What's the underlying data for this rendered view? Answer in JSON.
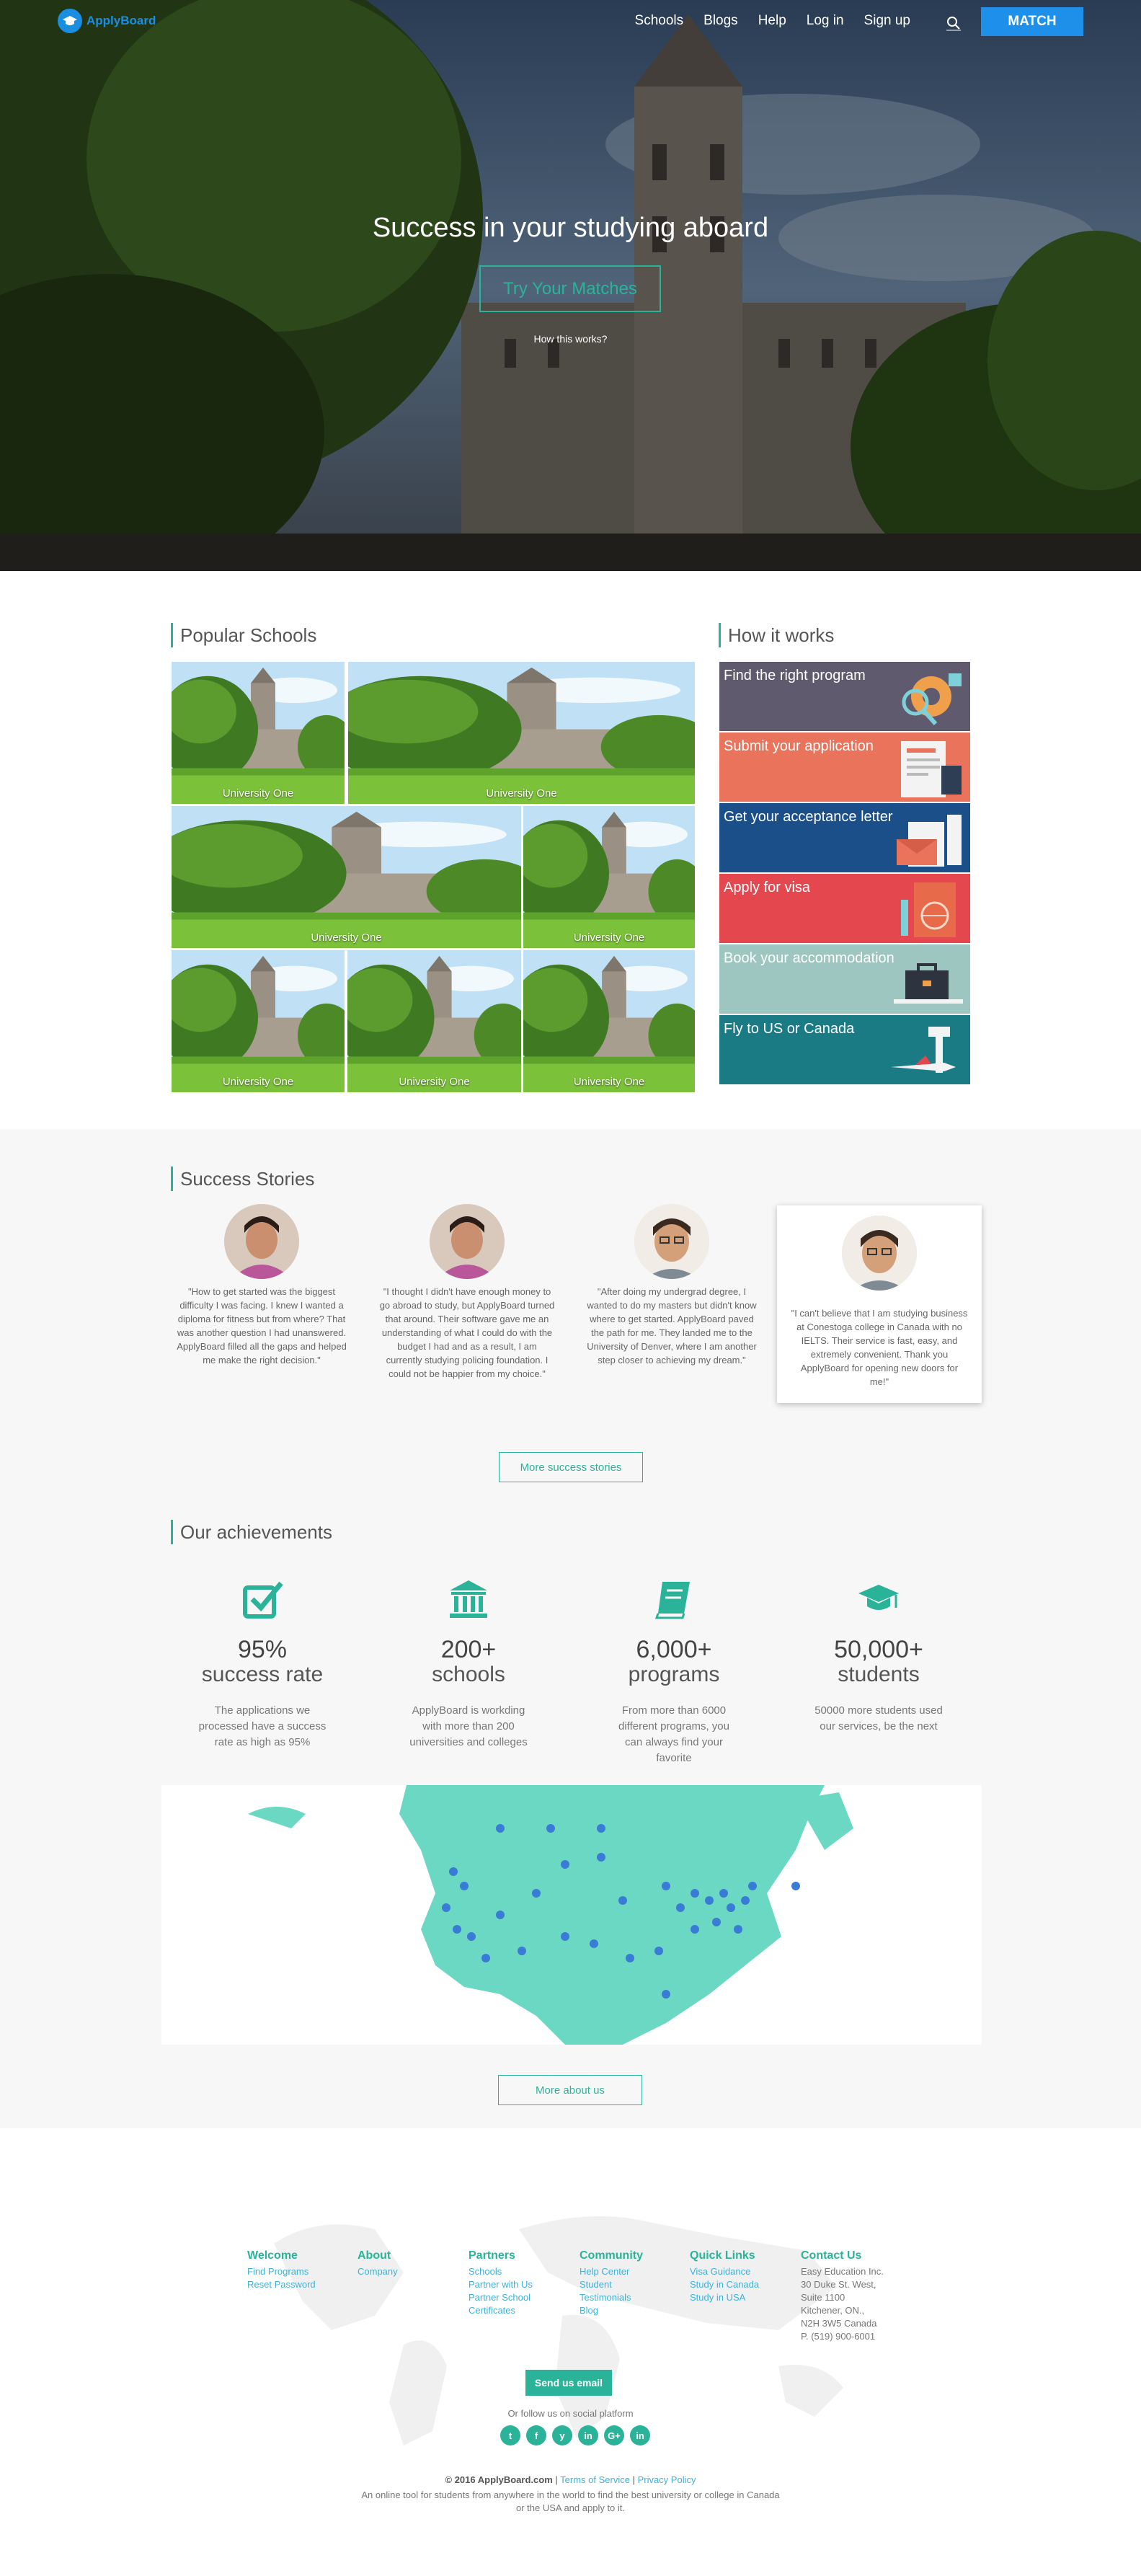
{
  "nav": {
    "logo_text": "ApplyBoard",
    "links": [
      "Schools",
      "Blogs",
      "Help",
      "Log in",
      "Sign up"
    ],
    "match_label": "MATCH"
  },
  "hero": {
    "title": "Success in your studying aboard",
    "cta_label": "Try Your Matches",
    "how_link": "How this works?"
  },
  "popular": {
    "heading": "Popular Schools",
    "tile_label": "University One"
  },
  "how": {
    "heading": "How it works",
    "steps": [
      {
        "label": "Find the right program",
        "color": "#5f5a6e"
      },
      {
        "label": "Submit your application",
        "color": "#e9735b"
      },
      {
        "label": "Get your acceptance letter",
        "color": "#1b4f8a"
      },
      {
        "label": "Apply for visa",
        "color": "#e5474f"
      },
      {
        "label": "Book your accommodation",
        "color": "#9cc6bf"
      },
      {
        "label": "Fly to US or Canada",
        "color": "#1b7b84"
      }
    ]
  },
  "stories": {
    "heading": "Success Stories",
    "items": [
      {
        "text": "\"How to get started was the biggest difficulty I was facing. I knew I wanted a diploma for fitness but from where? That was another question I had unanswered. ApplyBoard filled all the gaps and helped me make the right decision.\""
      },
      {
        "text": "\"I thought I didn't have enough money to go abroad to study, but ApplyBoard turned that around. Their software gave me an understanding of what I could do with the budget I had and as a result, I am currently studying policing foundation. I could not be happier from my choice.\""
      },
      {
        "text": "\"After doing my undergrad degree, I wanted to do my masters but didn't know where to get started. ApplyBoard paved the path for me. They landed me to the University of Denver, where I am another step closer to achieving my dream.\""
      },
      {
        "text": "\"I can't believe that I am studying business at Conestoga college in Canada with no IELTS. Their service is fast, easy, and extremely convenient. Thank you ApplyBoard for opening new doors for me!\""
      }
    ],
    "more_label": "More success stories"
  },
  "achievements": {
    "heading": "Our achievements",
    "items": [
      {
        "num": "95%",
        "unit": "success rate",
        "desc": "The applications we processed have a success rate as high as 95%",
        "icon": "checkbox-icon"
      },
      {
        "num": "200+",
        "unit": "schools",
        "desc": "ApplyBoard is workding with more than 200 universities and colleges",
        "icon": "institution-icon"
      },
      {
        "num": "6,000+",
        "unit": "programs",
        "desc": "From more than 6000 different programs, you can always find your favorite",
        "icon": "book-icon"
      },
      {
        "num": "50,000+",
        "unit": "students",
        "desc": "50000 more students used our services, be the next",
        "icon": "graduation-cap-icon"
      }
    ],
    "more_label": "More about us"
  },
  "footer": {
    "columns": [
      {
        "head": "Welcome",
        "links": [
          "Find Programs",
          "Reset Password"
        ]
      },
      {
        "head": "About",
        "links": [
          "Company"
        ]
      },
      {
        "head": "Partners",
        "links": [
          "Schools",
          "Partner with Us",
          "Partner School Certificates"
        ]
      },
      {
        "head": "Community",
        "links": [
          "Help Center",
          "Student Testimonials",
          "Blog"
        ]
      },
      {
        "head": "Quick Links",
        "links": [
          "Visa Guidance",
          "Study in Canada",
          "Study in USA"
        ]
      },
      {
        "head": "Contact Us",
        "lines": [
          "Easy Education Inc.",
          "30 Duke St. West,",
          "Suite 1100",
          "Kitchener, ON.,",
          "N2H 3W5 Canada",
          "P. (519) 900-6001"
        ]
      }
    ],
    "send_label": "Send us email",
    "follow_text": "Or follow us on social platform",
    "socials": [
      "t",
      "f",
      "y",
      "in",
      "G+",
      "in"
    ],
    "copyright": "© 2016 ApplyBoard.com",
    "terms": "Terms of Service",
    "privacy": "Privacy Policy",
    "tagline": "An online tool for students from anywhere in the world to find the best university or college in Canada or the USA and apply to it."
  },
  "colors": {
    "accent": "#2bb39a",
    "brand_blue": "#1e90ea"
  }
}
